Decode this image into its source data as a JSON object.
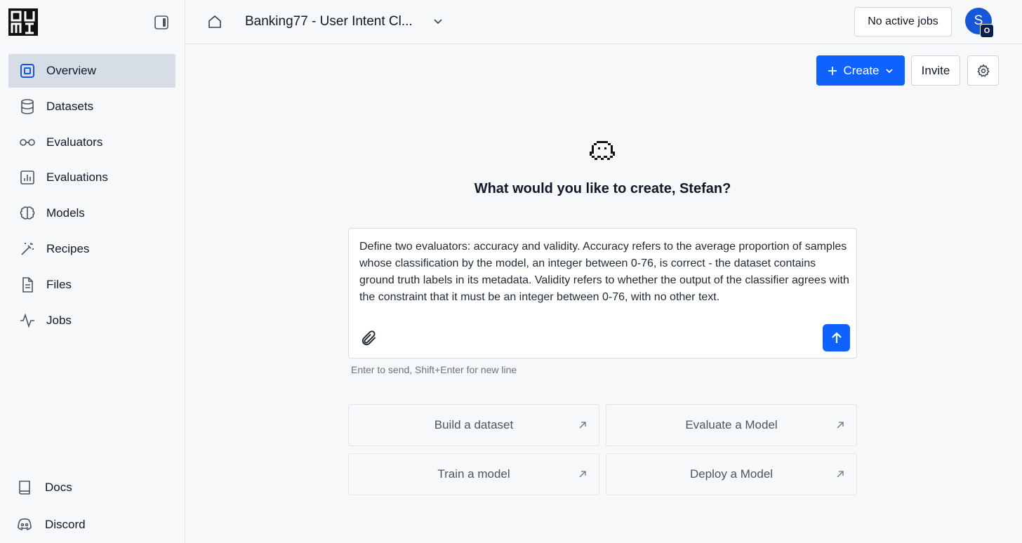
{
  "sidebar": {
    "items": [
      {
        "label": "Overview",
        "icon": "overview-icon",
        "active": true
      },
      {
        "label": "Datasets",
        "icon": "database-icon"
      },
      {
        "label": "Evaluators",
        "icon": "glasses-icon"
      },
      {
        "label": "Evaluations",
        "icon": "bar-chart-icon"
      },
      {
        "label": "Models",
        "icon": "brain-icon"
      },
      {
        "label": "Recipes",
        "icon": "magic-wand-icon"
      },
      {
        "label": "Files",
        "icon": "file-icon"
      },
      {
        "label": "Jobs",
        "icon": "activity-icon"
      }
    ],
    "bottom_items": [
      {
        "label": "Docs",
        "icon": "book-icon"
      },
      {
        "label": "Discord",
        "icon": "discord-icon"
      }
    ]
  },
  "header": {
    "project_title": "Banking77 - User Intent Cl...",
    "jobs_status": "No active jobs",
    "avatar_initial": "S",
    "avatar_badge": "O"
  },
  "toolbar": {
    "create_label": "Create",
    "invite_label": "Invite"
  },
  "main": {
    "prompt_title": "What would you like to create, Stefan?",
    "composer_text": "Define two evaluators: accuracy and validity. Accuracy refers to the average proportion of samples whose classification by the model, an integer between 0-76, is correct - the dataset contains ground truth labels in its metadata. Validity refers to whether the output of the classifier agrees with the constraint that it must be an integer between 0-76, with no other text.",
    "hint": "Enter to send, Shift+Enter for new line",
    "quick_actions": [
      {
        "label": "Build a dataset"
      },
      {
        "label": "Evaluate a Model"
      },
      {
        "label": "Train a model"
      },
      {
        "label": "Deploy a Model"
      }
    ]
  },
  "colors": {
    "accent": "#0f62fe",
    "active_nav_bg": "#d6dde6",
    "avatar": "#1557d6"
  }
}
